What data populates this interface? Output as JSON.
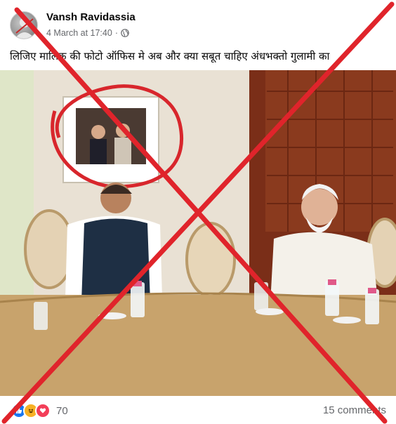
{
  "post": {
    "author": "Vansh Ravidassia",
    "timestamp": "4 March at 17:40",
    "separator": "·",
    "text": "लिजिए मालिक की फोटो ऑफिस मे अब और क्या सबूत चाहिए अंधभक्तो गुलामी का"
  },
  "footer": {
    "reaction_icons": [
      "like-icon",
      "haha-icon",
      "love-icon"
    ],
    "reaction_count": "70",
    "comments": "15 comments"
  },
  "colors": {
    "cross_red": "#e0242b",
    "like_blue": "#1877f2",
    "love_red": "#f33e58",
    "haha_yellow": "#f7b125"
  }
}
